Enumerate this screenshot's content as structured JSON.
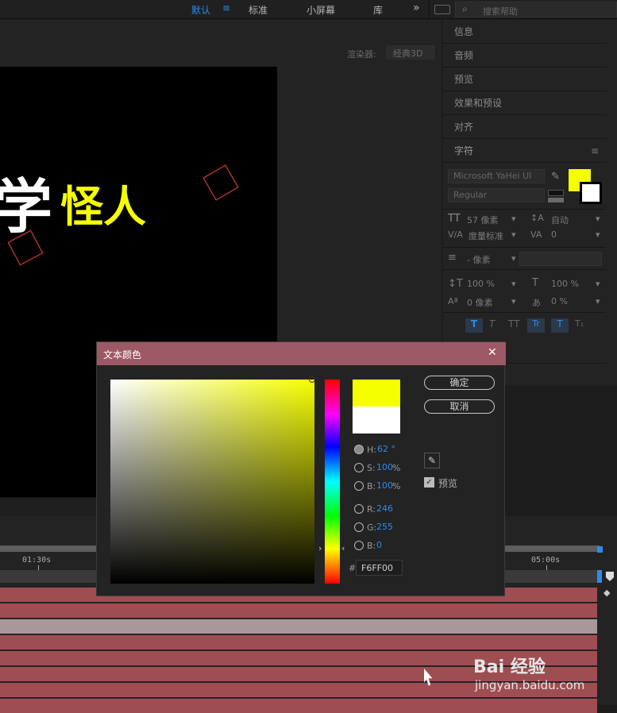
{
  "workspaces": {
    "default": "默认",
    "standard": "标准",
    "small_screen": "小屏幕",
    "library": "库",
    "more": "»"
  },
  "search": {
    "placeholder": "搜索帮助"
  },
  "comp": {
    "renderer_label": "渲染器:",
    "renderer_value": "经典3D",
    "text_big": "学",
    "text_yellow": "怪人"
  },
  "panel": {
    "items": [
      "信息",
      "音频",
      "预览",
      "效果和预设",
      "对齐",
      "字符"
    ],
    "menu_icon": "≡",
    "font_family": "Microsoft YaHei UI",
    "font_style": "Regular",
    "font_size": "57 像素",
    "leading": "自动",
    "kerning": "度量标准",
    "tracking": "0",
    "stroke_width": "- 像素",
    "vert_scale": "100 %",
    "horiz_scale": "100 %",
    "baseline": "0 像素",
    "tsume": "0 %",
    "styles": [
      "T",
      "T",
      "TT",
      "Tr",
      "T",
      "T₁"
    ],
    "fill_color": "#F6FF00"
  },
  "timeline": {
    "t1": "01:30s",
    "t2": "05:00s"
  },
  "dialog": {
    "title": "文本颜色",
    "close": "✕",
    "ok": "确定",
    "cancel": "取消",
    "h_label": "H:",
    "h_value": "62 °",
    "s_label": "S:",
    "s_value": "100",
    "s_unit": "%",
    "b_label": "B:",
    "b_value": "100",
    "b_unit": "%",
    "r_label": "R:",
    "r_value": "246",
    "g_label": "G:",
    "g_value": "255",
    "bb_label": "B:",
    "bb_value": "0",
    "hash": "#",
    "hex": "F6FF00",
    "preview_label": "预览",
    "new_color": "#F6FF00",
    "old_color": "#FFFFFF"
  },
  "watermark": {
    "brand": "Bai 经验",
    "url": "jingyan.baidu.com"
  }
}
